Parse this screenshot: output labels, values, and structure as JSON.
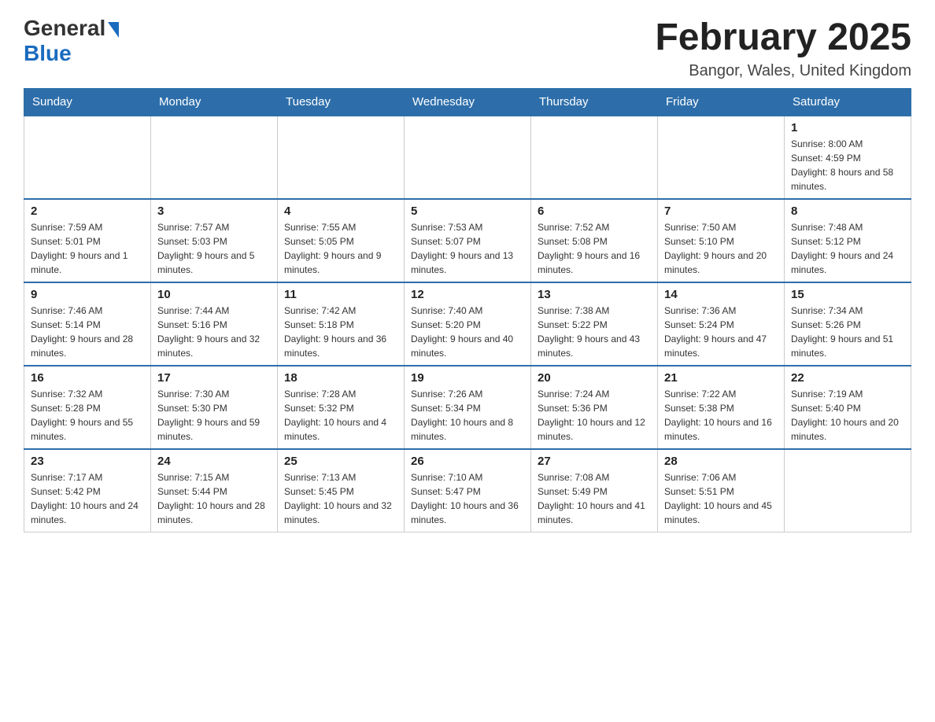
{
  "header": {
    "logo_general": "General",
    "logo_blue": "Blue",
    "month_title": "February 2025",
    "location": "Bangor, Wales, United Kingdom"
  },
  "weekdays": [
    "Sunday",
    "Monday",
    "Tuesday",
    "Wednesday",
    "Thursday",
    "Friday",
    "Saturday"
  ],
  "weeks": [
    [
      {
        "day": "",
        "info": ""
      },
      {
        "day": "",
        "info": ""
      },
      {
        "day": "",
        "info": ""
      },
      {
        "day": "",
        "info": ""
      },
      {
        "day": "",
        "info": ""
      },
      {
        "day": "",
        "info": ""
      },
      {
        "day": "1",
        "info": "Sunrise: 8:00 AM\nSunset: 4:59 PM\nDaylight: 8 hours and 58 minutes."
      }
    ],
    [
      {
        "day": "2",
        "info": "Sunrise: 7:59 AM\nSunset: 5:01 PM\nDaylight: 9 hours and 1 minute."
      },
      {
        "day": "3",
        "info": "Sunrise: 7:57 AM\nSunset: 5:03 PM\nDaylight: 9 hours and 5 minutes."
      },
      {
        "day": "4",
        "info": "Sunrise: 7:55 AM\nSunset: 5:05 PM\nDaylight: 9 hours and 9 minutes."
      },
      {
        "day": "5",
        "info": "Sunrise: 7:53 AM\nSunset: 5:07 PM\nDaylight: 9 hours and 13 minutes."
      },
      {
        "day": "6",
        "info": "Sunrise: 7:52 AM\nSunset: 5:08 PM\nDaylight: 9 hours and 16 minutes."
      },
      {
        "day": "7",
        "info": "Sunrise: 7:50 AM\nSunset: 5:10 PM\nDaylight: 9 hours and 20 minutes."
      },
      {
        "day": "8",
        "info": "Sunrise: 7:48 AM\nSunset: 5:12 PM\nDaylight: 9 hours and 24 minutes."
      }
    ],
    [
      {
        "day": "9",
        "info": "Sunrise: 7:46 AM\nSunset: 5:14 PM\nDaylight: 9 hours and 28 minutes."
      },
      {
        "day": "10",
        "info": "Sunrise: 7:44 AM\nSunset: 5:16 PM\nDaylight: 9 hours and 32 minutes."
      },
      {
        "day": "11",
        "info": "Sunrise: 7:42 AM\nSunset: 5:18 PM\nDaylight: 9 hours and 36 minutes."
      },
      {
        "day": "12",
        "info": "Sunrise: 7:40 AM\nSunset: 5:20 PM\nDaylight: 9 hours and 40 minutes."
      },
      {
        "day": "13",
        "info": "Sunrise: 7:38 AM\nSunset: 5:22 PM\nDaylight: 9 hours and 43 minutes."
      },
      {
        "day": "14",
        "info": "Sunrise: 7:36 AM\nSunset: 5:24 PM\nDaylight: 9 hours and 47 minutes."
      },
      {
        "day": "15",
        "info": "Sunrise: 7:34 AM\nSunset: 5:26 PM\nDaylight: 9 hours and 51 minutes."
      }
    ],
    [
      {
        "day": "16",
        "info": "Sunrise: 7:32 AM\nSunset: 5:28 PM\nDaylight: 9 hours and 55 minutes."
      },
      {
        "day": "17",
        "info": "Sunrise: 7:30 AM\nSunset: 5:30 PM\nDaylight: 9 hours and 59 minutes."
      },
      {
        "day": "18",
        "info": "Sunrise: 7:28 AM\nSunset: 5:32 PM\nDaylight: 10 hours and 4 minutes."
      },
      {
        "day": "19",
        "info": "Sunrise: 7:26 AM\nSunset: 5:34 PM\nDaylight: 10 hours and 8 minutes."
      },
      {
        "day": "20",
        "info": "Sunrise: 7:24 AM\nSunset: 5:36 PM\nDaylight: 10 hours and 12 minutes."
      },
      {
        "day": "21",
        "info": "Sunrise: 7:22 AM\nSunset: 5:38 PM\nDaylight: 10 hours and 16 minutes."
      },
      {
        "day": "22",
        "info": "Sunrise: 7:19 AM\nSunset: 5:40 PM\nDaylight: 10 hours and 20 minutes."
      }
    ],
    [
      {
        "day": "23",
        "info": "Sunrise: 7:17 AM\nSunset: 5:42 PM\nDaylight: 10 hours and 24 minutes."
      },
      {
        "day": "24",
        "info": "Sunrise: 7:15 AM\nSunset: 5:44 PM\nDaylight: 10 hours and 28 minutes."
      },
      {
        "day": "25",
        "info": "Sunrise: 7:13 AM\nSunset: 5:45 PM\nDaylight: 10 hours and 32 minutes."
      },
      {
        "day": "26",
        "info": "Sunrise: 7:10 AM\nSunset: 5:47 PM\nDaylight: 10 hours and 36 minutes."
      },
      {
        "day": "27",
        "info": "Sunrise: 7:08 AM\nSunset: 5:49 PM\nDaylight: 10 hours and 41 minutes."
      },
      {
        "day": "28",
        "info": "Sunrise: 7:06 AM\nSunset: 5:51 PM\nDaylight: 10 hours and 45 minutes."
      },
      {
        "day": "",
        "info": ""
      }
    ]
  ]
}
